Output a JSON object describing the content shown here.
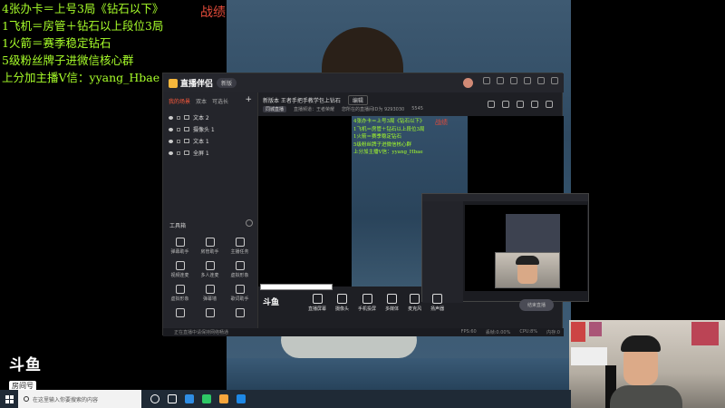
{
  "overlay": {
    "lines": [
      "4张办卡＝上号3局《钻石以下》",
      "1飞机＝房管＋钻石以上段位3局",
      "1火箭＝赛季稳定钻石",
      "5级粉丝牌子进微信核心群",
      "上分加主播V信：yyang_Hbae"
    ],
    "zhanji": "战绩"
  },
  "douyu": {
    "logo": "斗鱼",
    "room_label": "房间号",
    "room_number": "9293030"
  },
  "app": {
    "name": "直播伴侣",
    "version": "新版",
    "scene_tabs": [
      "我的场景",
      "双本",
      "可选长"
    ],
    "sources": [
      "文本 2",
      "摄像头 1",
      "文本 1",
      "全屏 1"
    ],
    "tools_title": "工具箱",
    "tools": [
      "弹幕助手",
      "房管助手",
      "主播任务",
      "视频连麦",
      "多人连麦",
      "虚拟形象",
      "虚拟形象",
      "弹幕墙",
      "歌词助手",
      "",
      "",
      ""
    ],
    "room_title": "新版本 王者手把手教学包上钻石",
    "title_edit": "编辑",
    "room_tag": "同城直播",
    "category": "直播频道：王者荣耀",
    "room_info": "您所在的直播间ID为 9293030",
    "online": "5545",
    "controls": [
      "直播屏幕",
      "摄像头",
      "手机投屏",
      "多媒体",
      "麦克风",
      "扬声器"
    ],
    "go_live": "结束直播",
    "status_tip": "正在直播中请保持网络畅通",
    "stats": [
      "FPS:60",
      "丢帧:0.00%",
      "CPU:8%",
      "内存:0"
    ]
  },
  "preview": {
    "lines": [
      "4张办卡＝上号3局《钻石以下》",
      "1飞机＝房管＋钻石以上段位3局",
      "1火箭＝赛季稳定钻石",
      "5级粉丝牌子进微信核心群",
      "上分加主播V信：yyang_Hbae"
    ],
    "zhanji": "战绩",
    "logo": "斗鱼"
  },
  "taskbar": {
    "search_placeholder": "在这里输入你要搜索的内容"
  }
}
